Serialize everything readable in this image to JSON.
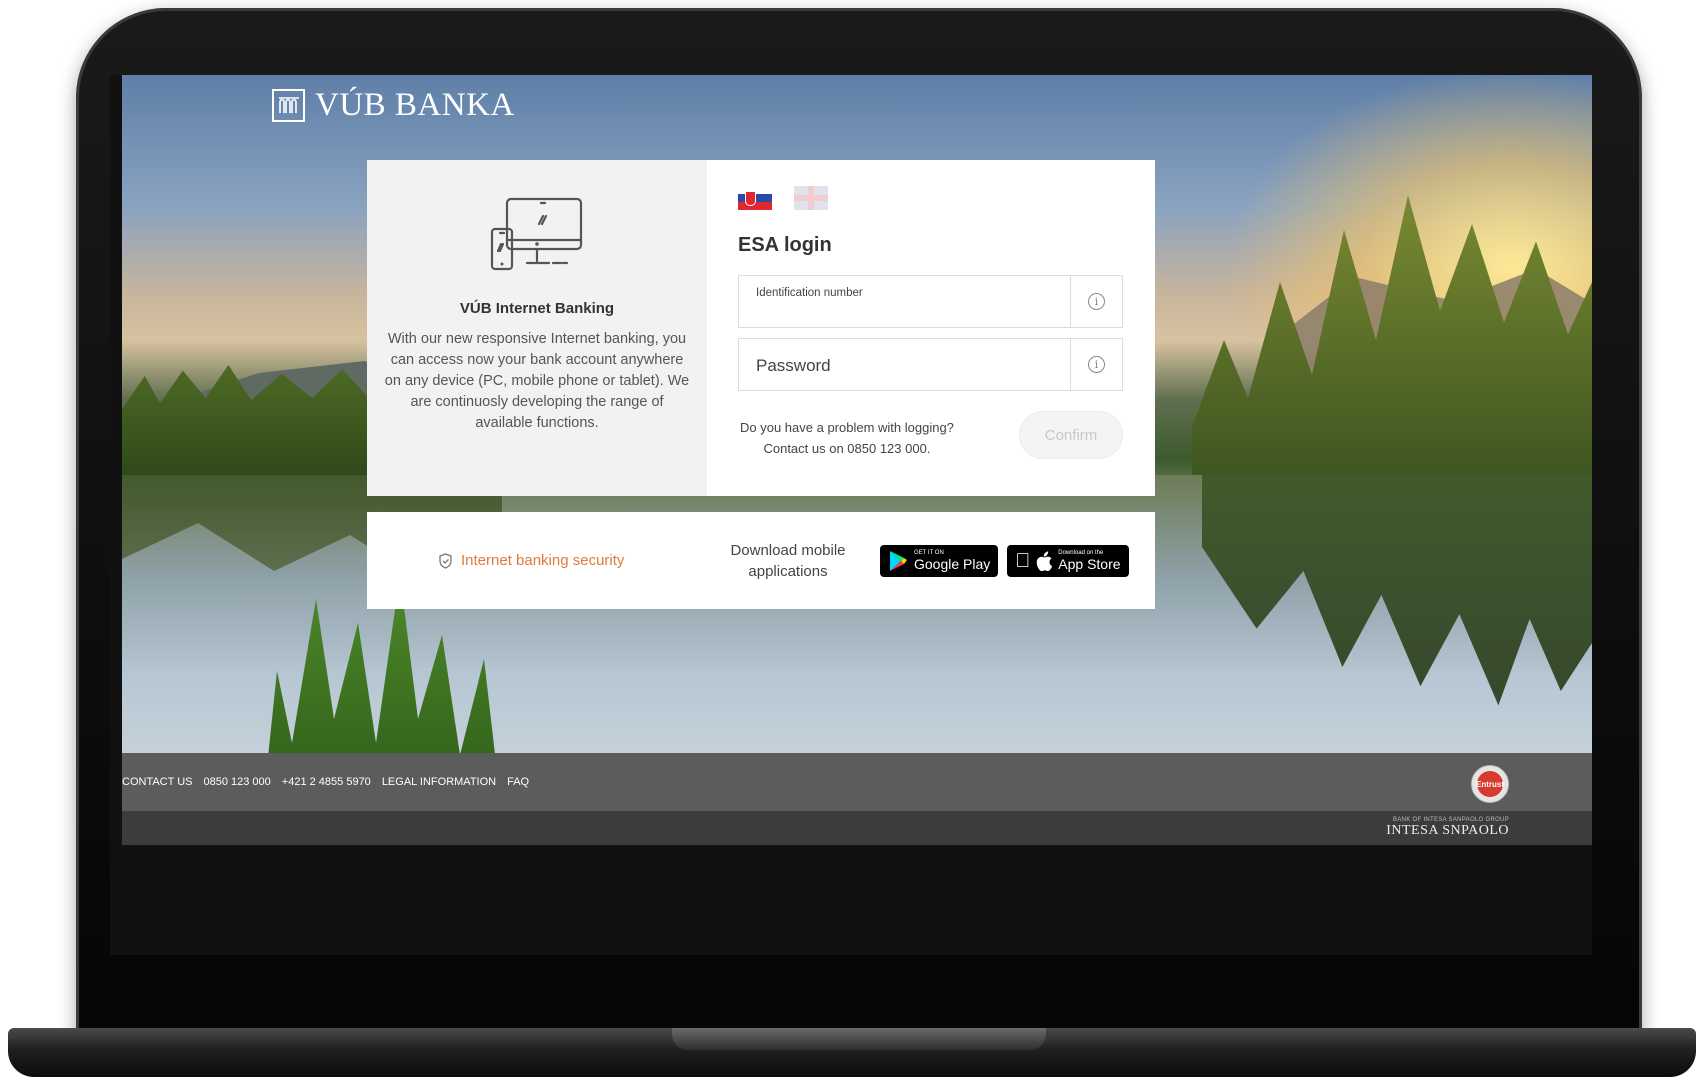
{
  "brand": {
    "name": "VÚB BANKA",
    "accent": "#e07a3a"
  },
  "info_panel": {
    "title": "VÚB Internet Banking",
    "text": "With our new responsive Internet banking, you can access now your bank account anywhere on any device (PC, mobile phone or tablet). We are continuosly developing the range of available functions."
  },
  "login": {
    "languages": [
      "sk-flag",
      "uk-flag"
    ],
    "title": "ESA login",
    "id_label": "Identification number",
    "password_placeholder": "Password",
    "help_line1": "Do you have a problem with logging?",
    "help_line2": "Contact us on 0850 123 000.",
    "confirm_label": "Confirm"
  },
  "strip": {
    "security_link": "Internet banking security",
    "download_text": "Download mobile applications",
    "google_small": "GET IT ON",
    "google_big": "Google Play",
    "apple_small": "Download on the",
    "apple_big": "App Store"
  },
  "footer": {
    "links": [
      "CONTACT US",
      "0850 123 000",
      "+421 2 4855 5970",
      "LEGAL INFORMATION",
      "FAQ"
    ],
    "entrust": "Entrust",
    "group_small": "BANK OF INTESA SANPAOLO GROUP",
    "group_big": "INTESA SNPAOLO"
  }
}
